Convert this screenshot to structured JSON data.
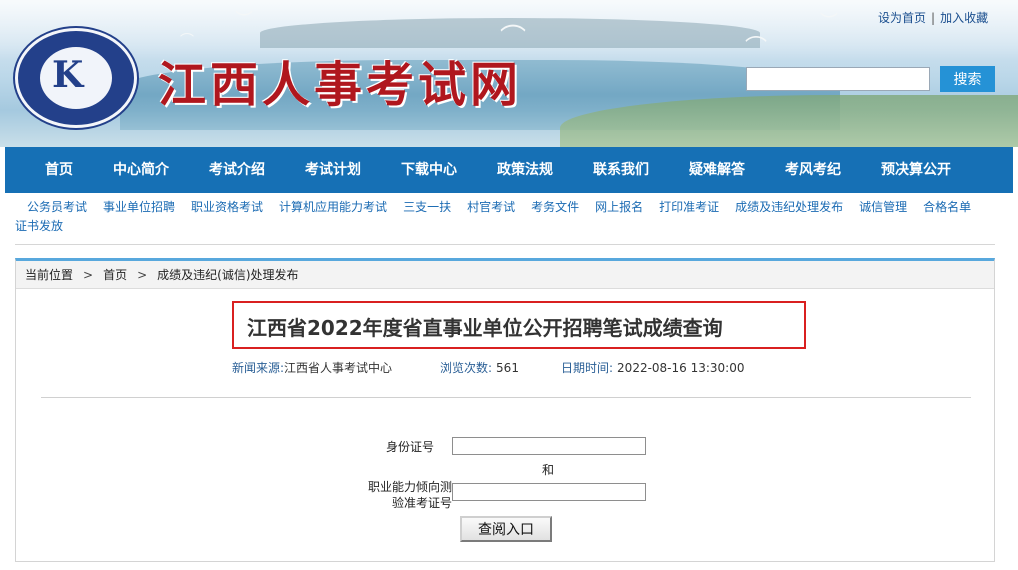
{
  "header": {
    "site_title": "江西人事考试网",
    "top_links": {
      "set_home": "设为首页",
      "separator": "|",
      "add_favorite": "加入收藏"
    },
    "search": {
      "placeholder": "",
      "button_label": "搜索"
    }
  },
  "main_nav": {
    "items": [
      "首页",
      "中心简介",
      "考试介绍",
      "考试计划",
      "下载中心",
      "政策法规",
      "联系我们",
      "疑难解答",
      "考风考纪",
      "预决算公开"
    ]
  },
  "sub_nav": {
    "items": [
      "公务员考试",
      "事业单位招聘",
      "职业资格考试",
      "计算机应用能力考试",
      "三支一扶",
      "村官考试",
      "考务文件",
      "网上报名",
      "打印准考证",
      "成绩及违纪处理发布",
      "诚信管理",
      "合格名单",
      "证书发放"
    ]
  },
  "breadcrumb": {
    "label": "当前位置",
    "arrow": ">",
    "home": "首页",
    "current": "成绩及违纪(诚信)处理发布"
  },
  "article": {
    "title": "江西省2022年度省直事业单位公开招聘笔试成绩查询",
    "meta": {
      "source_label": "新闻来源:",
      "source_value": "江西省人事考试中心",
      "views_label": "浏览次数:",
      "views_value": "561",
      "date_label": "日期时间:",
      "date_value": "2022-08-16 13:30:00"
    }
  },
  "query_form": {
    "id_label": "身份证号",
    "and_label": "和",
    "ticket_label_line1": "职业能力倾向测",
    "ticket_label_line2": "验准考证号",
    "submit_label": "查阅入口"
  },
  "colors": {
    "nav_bg": "#1670b5",
    "title_red": "#b0171e",
    "highlight_border": "#d92020",
    "link_blue": "#1b6bb3",
    "search_button": "#2592d6"
  }
}
